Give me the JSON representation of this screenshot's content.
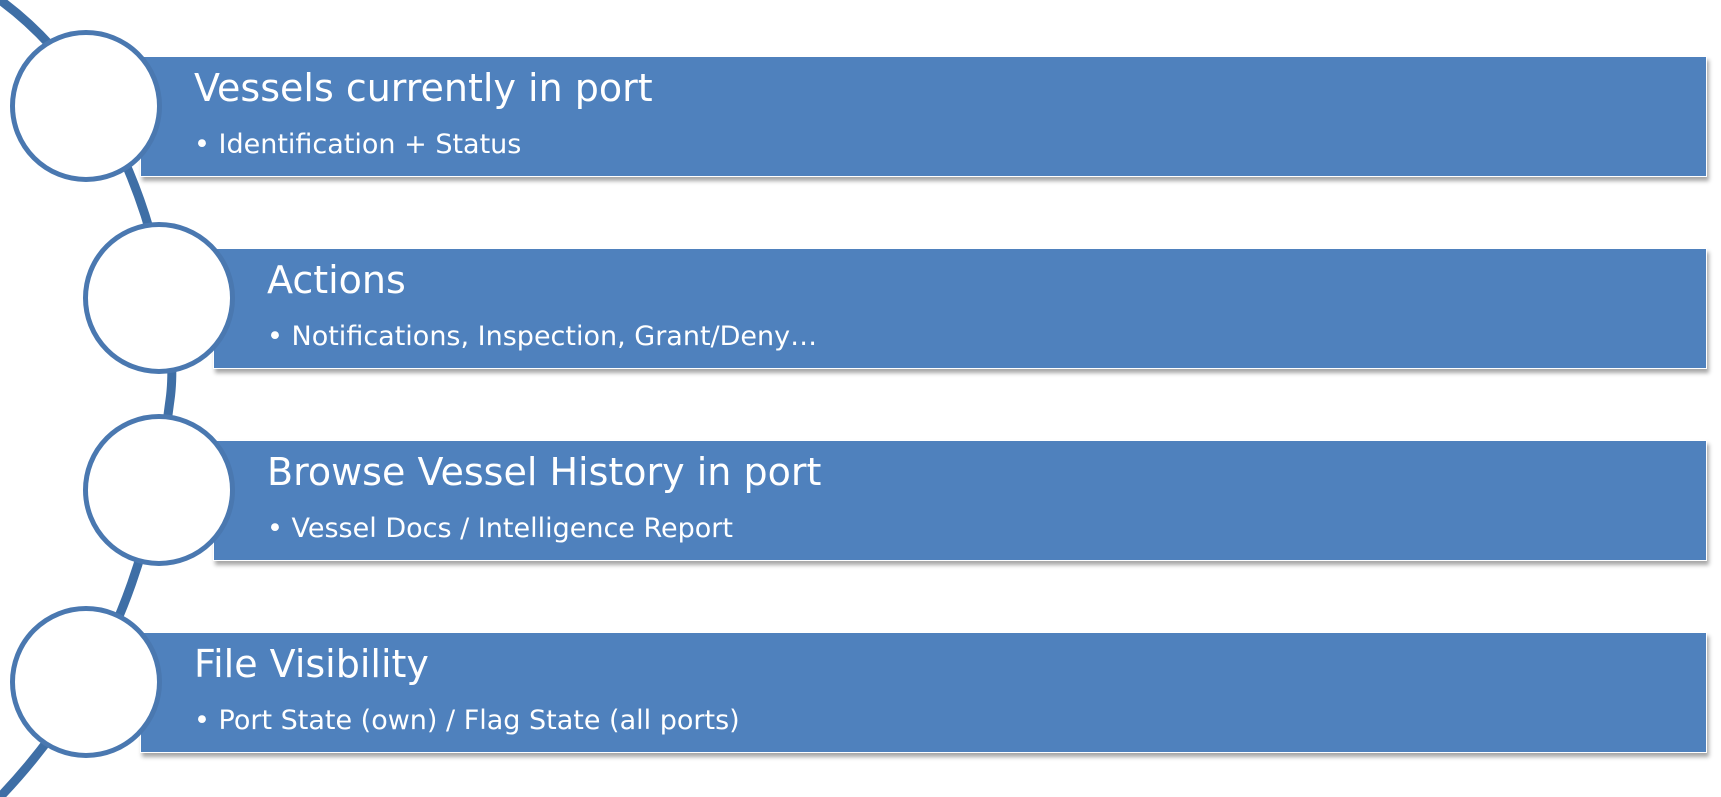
{
  "colors": {
    "bar": "#4f81bd",
    "circle_border": "#4a78b0",
    "text": "#ffffff",
    "arc": "#3f6fa6"
  },
  "items": [
    {
      "title": "Vessels currently in port",
      "bullet": "• Identification + Status"
    },
    {
      "title": "Actions",
      "bullet": "• Notifications, Inspection, Grant/Deny…"
    },
    {
      "title": "Browse Vessel History in port",
      "bullet": "• Vessel Docs / Intelligence Report"
    },
    {
      "title": "File Visibility",
      "bullet": "• Port State (own) / Flag State (all ports)"
    }
  ]
}
